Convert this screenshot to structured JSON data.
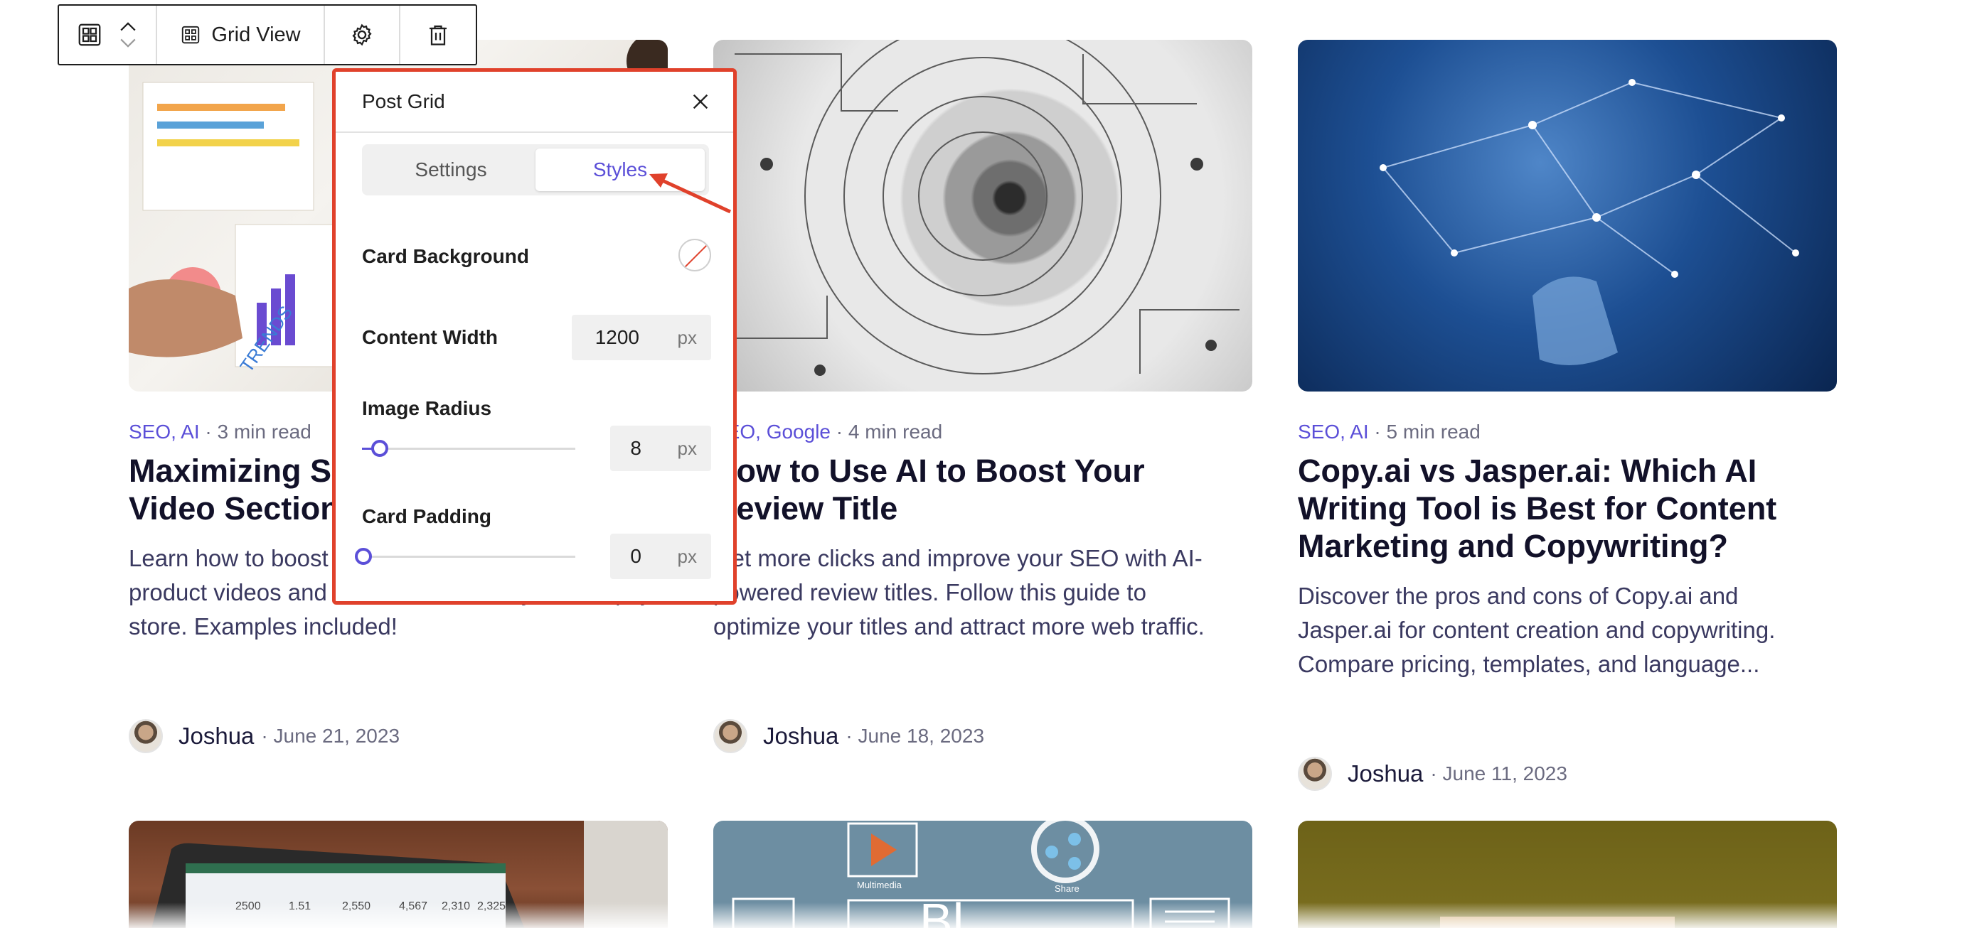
{
  "toolbar": {
    "view_label": "Grid View"
  },
  "popover": {
    "title": "Post Grid",
    "tabs": [
      {
        "label": "Settings",
        "active": false
      },
      {
        "label": "Styles",
        "active": true
      }
    ],
    "card_background": {
      "label": "Card Background",
      "value": "none"
    },
    "content_width": {
      "label": "Content Width",
      "value": "1200",
      "unit": "px"
    },
    "image_radius": {
      "label": "Image Radius",
      "value": "8",
      "unit": "px"
    },
    "card_padding": {
      "label": "Card Padding",
      "value": "0",
      "unit": "px"
    }
  },
  "cards": [
    {
      "categories": [
        "SEO,",
        "AI"
      ],
      "read_time": "· 3 min read",
      "title": "Maximizing Sales with a Product Video Section in Shopify",
      "excerpt": "Learn how to boost sales by creating effective product videos and a video section in your Shopify store. Examples included!",
      "author": "Joshua",
      "date": "· June 21, 2023"
    },
    {
      "categories": [
        "SEO,",
        "Google"
      ],
      "read_time": "· 4 min read",
      "title": "How to Use AI to Boost Your Review Title",
      "excerpt": "Get more clicks and improve your SEO with AI-powered review titles. Follow this guide to optimize your titles and attract more web traffic.",
      "author": "Joshua",
      "date": "· June 18, 2023"
    },
    {
      "categories": [
        "SEO,",
        "AI"
      ],
      "read_time": "· 5 min read",
      "title": "Copy.ai vs Jasper.ai: Which AI Writing Tool is Best for Content Marketing and Copywriting?",
      "excerpt": "Discover the pros and cons of Copy.ai and Jasper.ai for content creation and copywriting. Compare pricing, templates, and language...",
      "author": "Joshua",
      "date": "· June 11, 2023"
    }
  ],
  "colors": {
    "accent": "#5b4fd8",
    "highlight": "#e0412b"
  }
}
